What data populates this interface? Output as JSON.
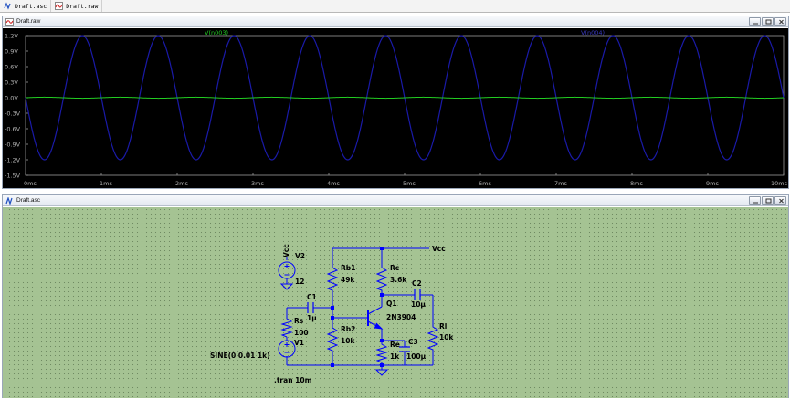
{
  "tabs": [
    {
      "label": "Draft.asc",
      "icon": "schematic-icon"
    },
    {
      "label": "Draft.raw",
      "icon": "waveform-icon"
    }
  ],
  "plot_window": {
    "title": "Draft.raw",
    "traces": [
      {
        "label": "V(n003)",
        "color": "#22cc22"
      },
      {
        "label": "V(n004)",
        "color": "#1a1aa8"
      }
    ],
    "y_ticks": [
      "1.2V",
      "0.9V",
      "0.6V",
      "0.3V",
      "0.0V",
      "-0.3V",
      "-0.6V",
      "-0.9V",
      "-1.2V",
      "-1.5V"
    ],
    "x_ticks": [
      "0ms",
      "1ms",
      "2ms",
      "3ms",
      "4ms",
      "5ms",
      "6ms",
      "7ms",
      "8ms",
      "9ms",
      "10ms"
    ]
  },
  "schematic_window": {
    "title": "Draft.asc",
    "labels": {
      "vcc_source": "Vcc",
      "v2_name": "V2",
      "v2_value": "12",
      "vcc_net": "Vcc",
      "rb1_name": "Rb1",
      "rb1_value": "49k",
      "rc_name": "Rc",
      "rc_value": "3.6k",
      "c2_name": "C2",
      "c2_value": "10µ",
      "c1_name": "C1",
      "c1_value": "1µ",
      "q1_name": "Q1",
      "q1_model": "2N3904",
      "rs_name": "Rs",
      "rs_value": "100",
      "rb2_name": "Rb2",
      "rb2_value": "10k",
      "rl_name": "Rl",
      "rl_value": "10k",
      "v1_name": "V1",
      "v1_value": "SINE(0 0.01 1k)",
      "re_name": "Re",
      "re_value": "1k",
      "c3_name": "C3",
      "c3_value": "100µ",
      "directive": ".tran 10m"
    }
  }
}
